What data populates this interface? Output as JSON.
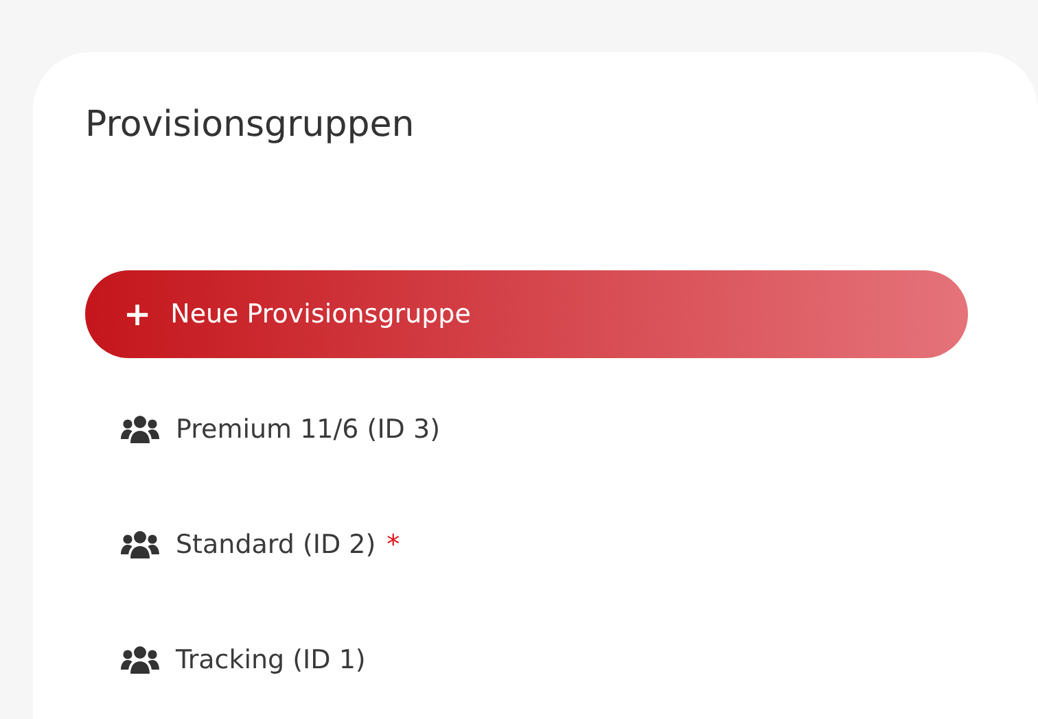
{
  "card": {
    "title": "Provisionsgruppen"
  },
  "new_button": {
    "icon": "+",
    "label": "Neue Provisionsgruppe"
  },
  "groups": [
    {
      "label": "Premium 11/6 (ID 3)"
    },
    {
      "label": "Standard (ID 2)",
      "marker": "*"
    },
    {
      "label": "Tracking (ID 1)"
    }
  ]
}
